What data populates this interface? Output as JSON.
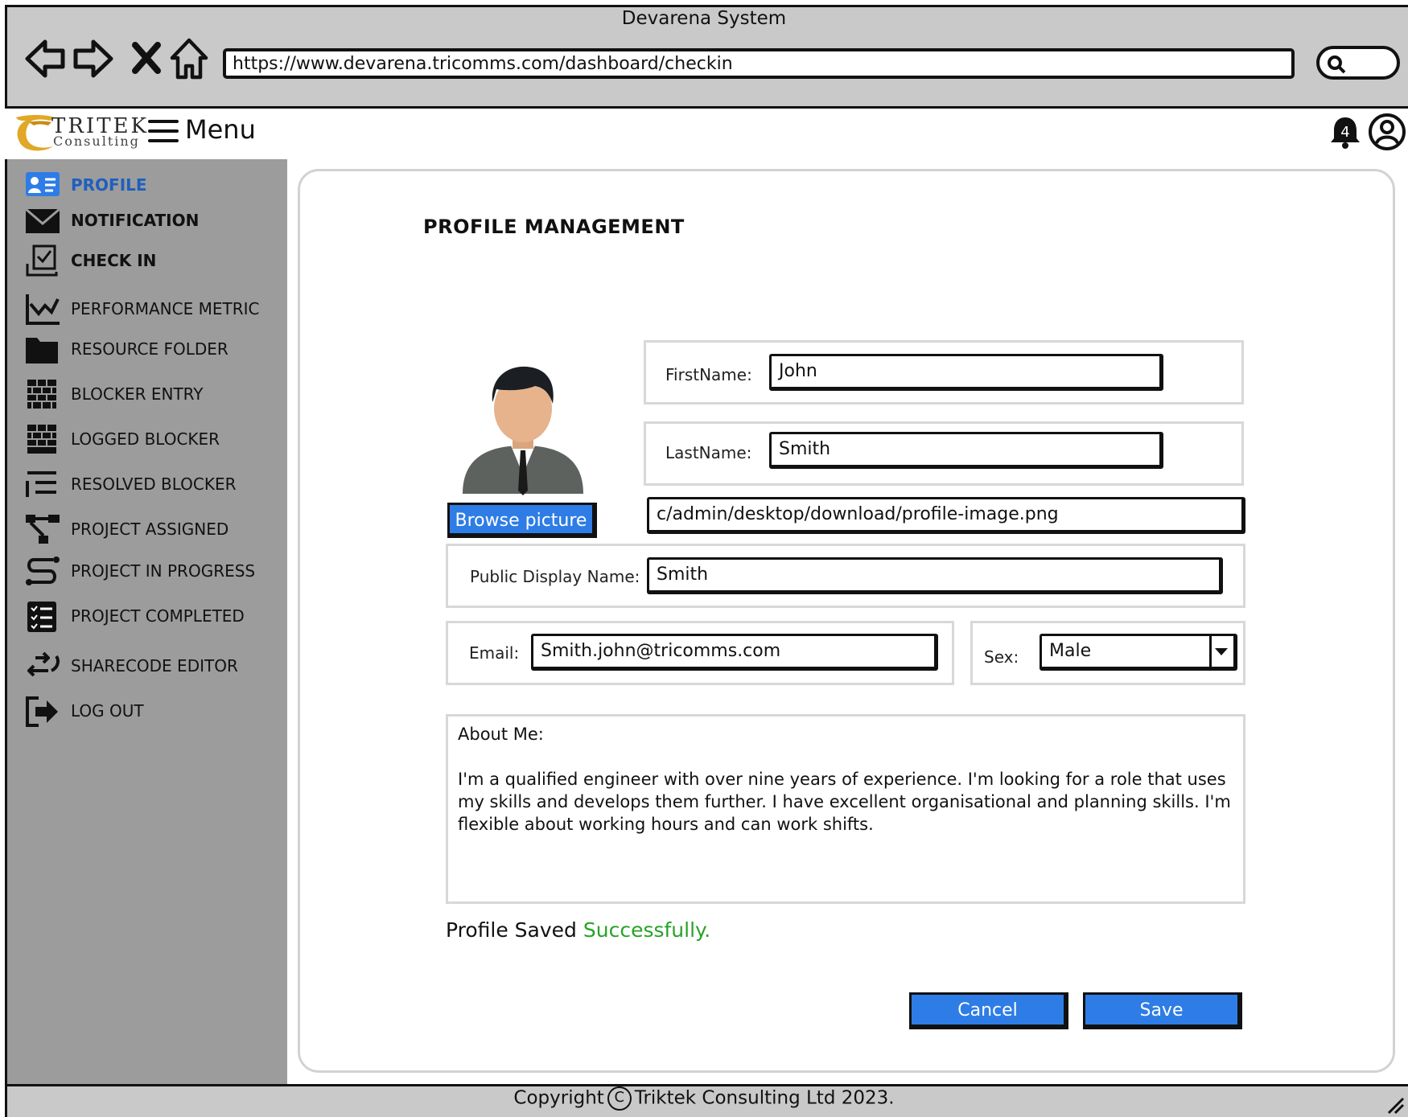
{
  "browser": {
    "window_title": "Devarena System",
    "url": "https://www.devarena.tricomms.com/dashboard/checkin"
  },
  "header": {
    "logo_word": "TRITEK",
    "logo_sub": "Consulting",
    "menu_label": "Menu",
    "notification_count": "4"
  },
  "sidebar": {
    "items": [
      {
        "label": "PROFILE",
        "icon": "profile-card-icon"
      },
      {
        "label": "NOTIFICATION",
        "icon": "envelope-icon"
      },
      {
        "label": "CHECK IN",
        "icon": "check-in-icon"
      },
      {
        "label": "PERFORMANCE METRIC",
        "icon": "chart-icon"
      },
      {
        "label": "RESOURCE FOLDER",
        "icon": "folder-icon"
      },
      {
        "label": "BLOCKER ENTRY",
        "icon": "brick-wall-icon"
      },
      {
        "label": "LOGGED BLOCKER",
        "icon": "brick-wall-icon"
      },
      {
        "label": "RESOLVED BLOCKER",
        "icon": "list-icon"
      },
      {
        "label": "PROJECT ASSIGNED",
        "icon": "hierarchy-icon"
      },
      {
        "label": "PROJECT IN PROGRESS",
        "icon": "flow-icon"
      },
      {
        "label": "PROJECT COMPLETED",
        "icon": "checklist-icon"
      },
      {
        "label": "SHARECODE EDITOR",
        "icon": "share-arrows-icon"
      },
      {
        "label": "LOG OUT",
        "icon": "logout-icon"
      }
    ]
  },
  "main": {
    "title": "PROFILE MANAGEMENT",
    "browse_label": "Browse picture",
    "image_path": "c/admin/desktop/download/profile-image.png",
    "first_name": {
      "label": "FirstName:",
      "value": "John"
    },
    "last_name": {
      "label": "LastName:",
      "value": "Smith"
    },
    "display_name": {
      "label": "Public Display Name:",
      "value": "Smith"
    },
    "email": {
      "label": "Email:",
      "value": "Smith.john@tricomms.com"
    },
    "sex": {
      "label": "Sex:",
      "value": "Male"
    },
    "about": {
      "label": "About Me:",
      "text": "I'm a qualified engineer with over nine years of experience. I'm looking for a role that uses my skills and develops them further. I have excellent organisational and planning skills. I'm flexible about working hours and can work shifts."
    },
    "status_prefix": "Profile Saved",
    "status_success": "Successfully.",
    "cancel_label": "Cancel",
    "save_label": "Save"
  },
  "footer": {
    "copyright_prefix": "Copyright",
    "copyright_mark": "C",
    "copyright_suffix": "Triktek Consulting Ltd 2023."
  },
  "colors": {
    "accent_blue": "#2e7de6",
    "active_text": "#1f5fbf",
    "success_green": "#27a327",
    "sidebar_bg": "#9c9c9c",
    "chrome_bg": "#c9c9c9"
  }
}
